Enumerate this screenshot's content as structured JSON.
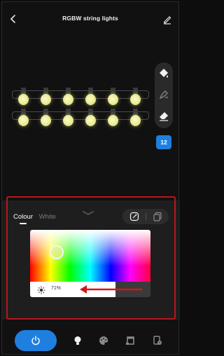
{
  "header": {
    "title": "RGBW string lights"
  },
  "tools": {
    "count_badge": "12"
  },
  "panel": {
    "tabs": [
      {
        "label": "Colour",
        "active": true
      },
      {
        "label": "White",
        "active": false
      }
    ],
    "brightness": {
      "label": "71%",
      "value_percent": 71
    }
  },
  "colors": {
    "accent": "#1f7fe0",
    "highlight": "#b8171c",
    "bulb_glow": "#e9eb90"
  },
  "icons": {
    "back": "chevron-left-icon",
    "edit": "pencil-icon",
    "paint_bucket": "paint-bucket-icon",
    "brush": "brush-icon",
    "eraser": "eraser-icon",
    "collapse": "chevron-down-icon",
    "mode_a": "edit-square-icon",
    "mode_b": "copy-icon",
    "sun": "sun-icon",
    "power": "power-icon",
    "bulb": "bulb-icon",
    "palette": "palette-icon",
    "music": "music-icon",
    "schedule": "schedule-icon"
  }
}
